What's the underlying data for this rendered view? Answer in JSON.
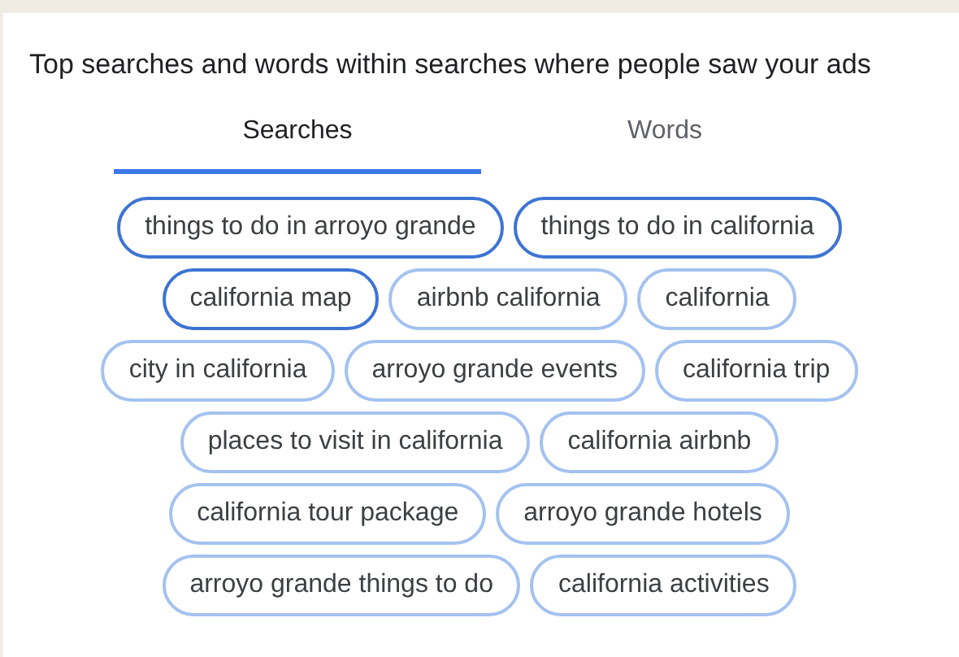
{
  "title": "Top searches and words within searches where people saw your ads",
  "tabs": [
    {
      "label": "Searches",
      "selected": true
    },
    {
      "label": "Words",
      "selected": false
    }
  ],
  "chip_rows": [
    [
      {
        "label": "things to do in arroyo grande",
        "highlighted": true
      },
      {
        "label": "things to do in california",
        "highlighted": true
      }
    ],
    [
      {
        "label": "california map",
        "highlighted": true
      },
      {
        "label": "airbnb california",
        "highlighted": false
      },
      {
        "label": "california",
        "highlighted": false
      }
    ],
    [
      {
        "label": "city in california",
        "highlighted": false
      },
      {
        "label": "arroyo grande events",
        "highlighted": false
      },
      {
        "label": "california trip",
        "highlighted": false
      }
    ],
    [
      {
        "label": "places to visit in california",
        "highlighted": false
      },
      {
        "label": "california airbnb",
        "highlighted": false
      }
    ],
    [
      {
        "label": "california tour package",
        "highlighted": false
      },
      {
        "label": "arroyo grande hotels",
        "highlighted": false
      }
    ],
    [
      {
        "label": "arroyo grande things to do",
        "highlighted": false
      },
      {
        "label": "california activities",
        "highlighted": false
      }
    ]
  ]
}
